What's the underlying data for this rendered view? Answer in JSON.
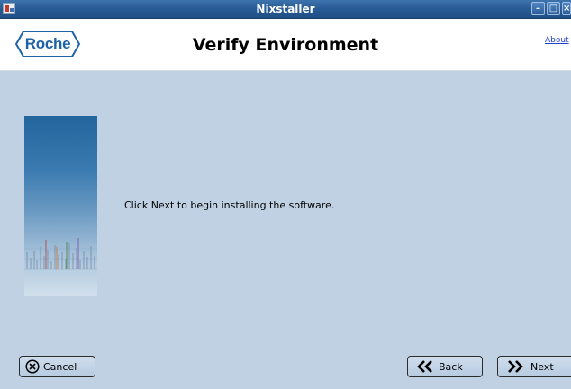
{
  "window": {
    "title": "Nixstaller",
    "controls": [
      "minimize",
      "maximize",
      "close"
    ]
  },
  "header": {
    "logo_text": "Roche",
    "page_title": "Verify Environment",
    "about_link": "About"
  },
  "content": {
    "message": "Click Next to begin installing the software."
  },
  "buttons": {
    "cancel": "Cancel",
    "back": "Back",
    "next": "Next"
  },
  "colors": {
    "titlebar": "#2a5d95",
    "content_background": "#bfd1e3",
    "logo_blue": "#1e63a8",
    "link": "#1f3fcf"
  },
  "icons": {
    "app": "nixstaller-app-icon",
    "cancel": "x-circle-icon",
    "back": "double-chevron-left-icon",
    "next": "double-chevron-right-icon"
  }
}
